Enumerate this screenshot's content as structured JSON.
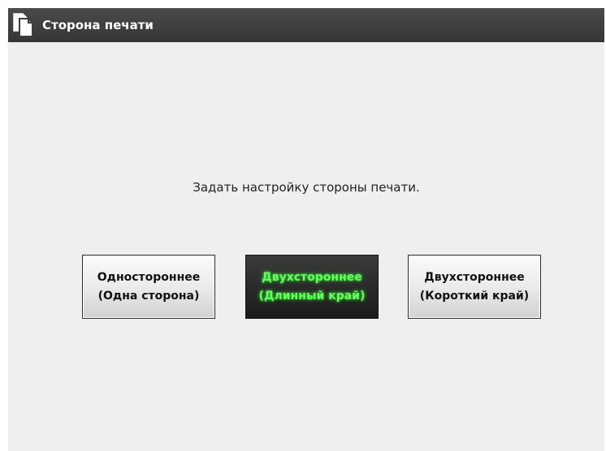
{
  "window": {
    "title": "Сторона печати",
    "icon": "document-copy-icon"
  },
  "main": {
    "message": "Задать настройку стороны печати.",
    "options": [
      {
        "id": "simplex",
        "label": "Одностороннее\n(Одна сторона)",
        "selected": false
      },
      {
        "id": "duplex-long",
        "label": "Двухстороннее\n(Длинный край)",
        "selected": true
      },
      {
        "id": "duplex-short",
        "label": "Двухстороннее\n(Короткий край)",
        "selected": false
      }
    ]
  },
  "colors": {
    "titlebar": "#3d3d3d",
    "background": "#efefef",
    "selected_text": "#62ff5a",
    "selected_button": "#2a2a2a"
  }
}
